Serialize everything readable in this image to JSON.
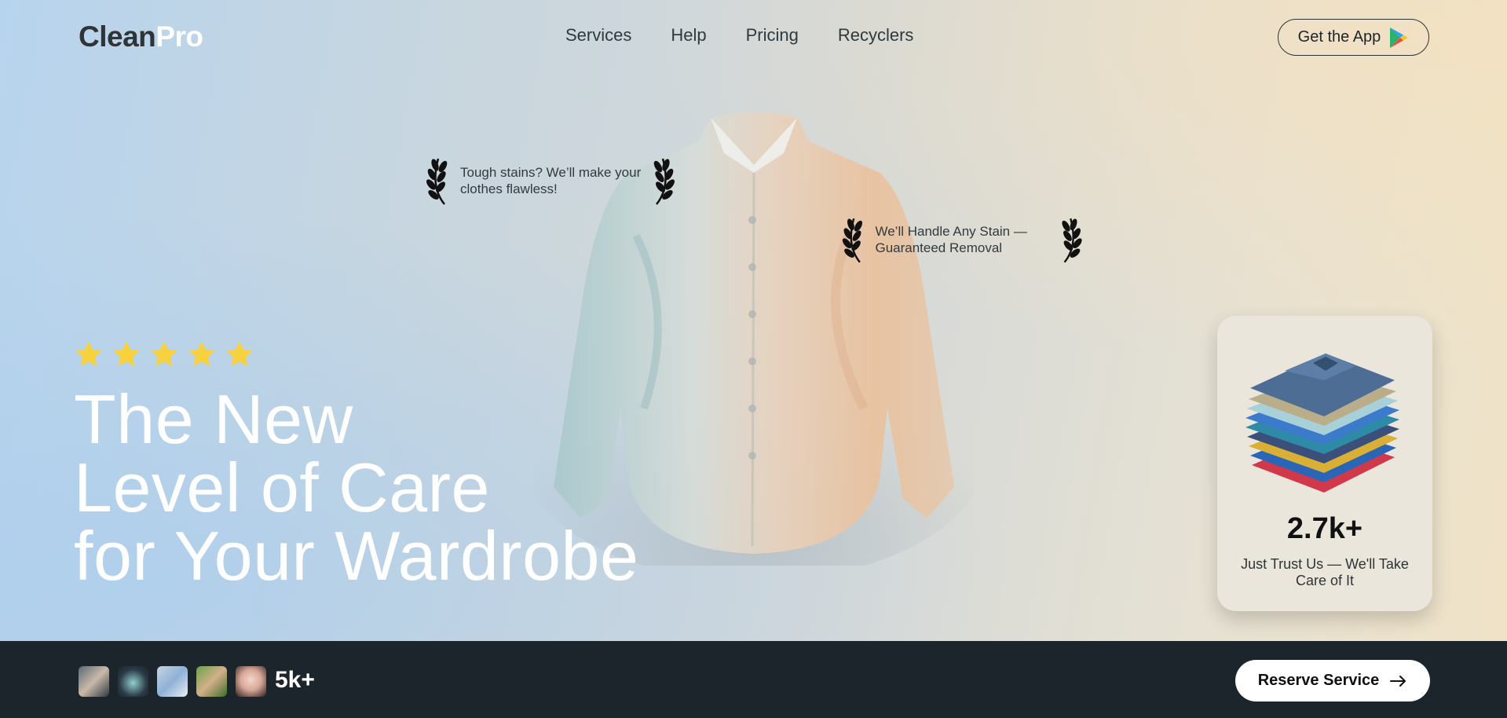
{
  "brand": {
    "part1": "Clean",
    "part2": "Pro"
  },
  "nav": {
    "items": [
      "Services",
      "Help",
      "Pricing",
      "Recyclers"
    ]
  },
  "header": {
    "app_button_label": "Get the App",
    "app_button_icon": "play-store-icon"
  },
  "badges": [
    {
      "text": "Tough stains? We’ll make your clothes flawless!",
      "icon": "laurel-icon"
    },
    {
      "text": "We’ll Handle Any Stain — Guaranteed Removal",
      "icon": "laurel-icon"
    }
  ],
  "hero": {
    "rating": {
      "value": 5,
      "max": 5
    },
    "headline_lines": [
      "The New",
      "Level of Care",
      "for Your Wardrobe"
    ]
  },
  "stat_card": {
    "value": "2.7k+",
    "caption": "Just Trust Us — We'll Take Care of It",
    "image": "folded-shirts-stack"
  },
  "footer": {
    "customers_count": "5k+",
    "avatars": [
      "avatar-1",
      "avatar-2",
      "avatar-3",
      "avatar-4",
      "avatar-5"
    ],
    "reserve_label": "Reserve Service",
    "reserve_icon": "arrow-right-icon"
  },
  "colors": {
    "footer_bg": "#1c252b",
    "star": "#f7d23e",
    "headline": "#ffffff",
    "card_bg": "#ebe6dc"
  }
}
